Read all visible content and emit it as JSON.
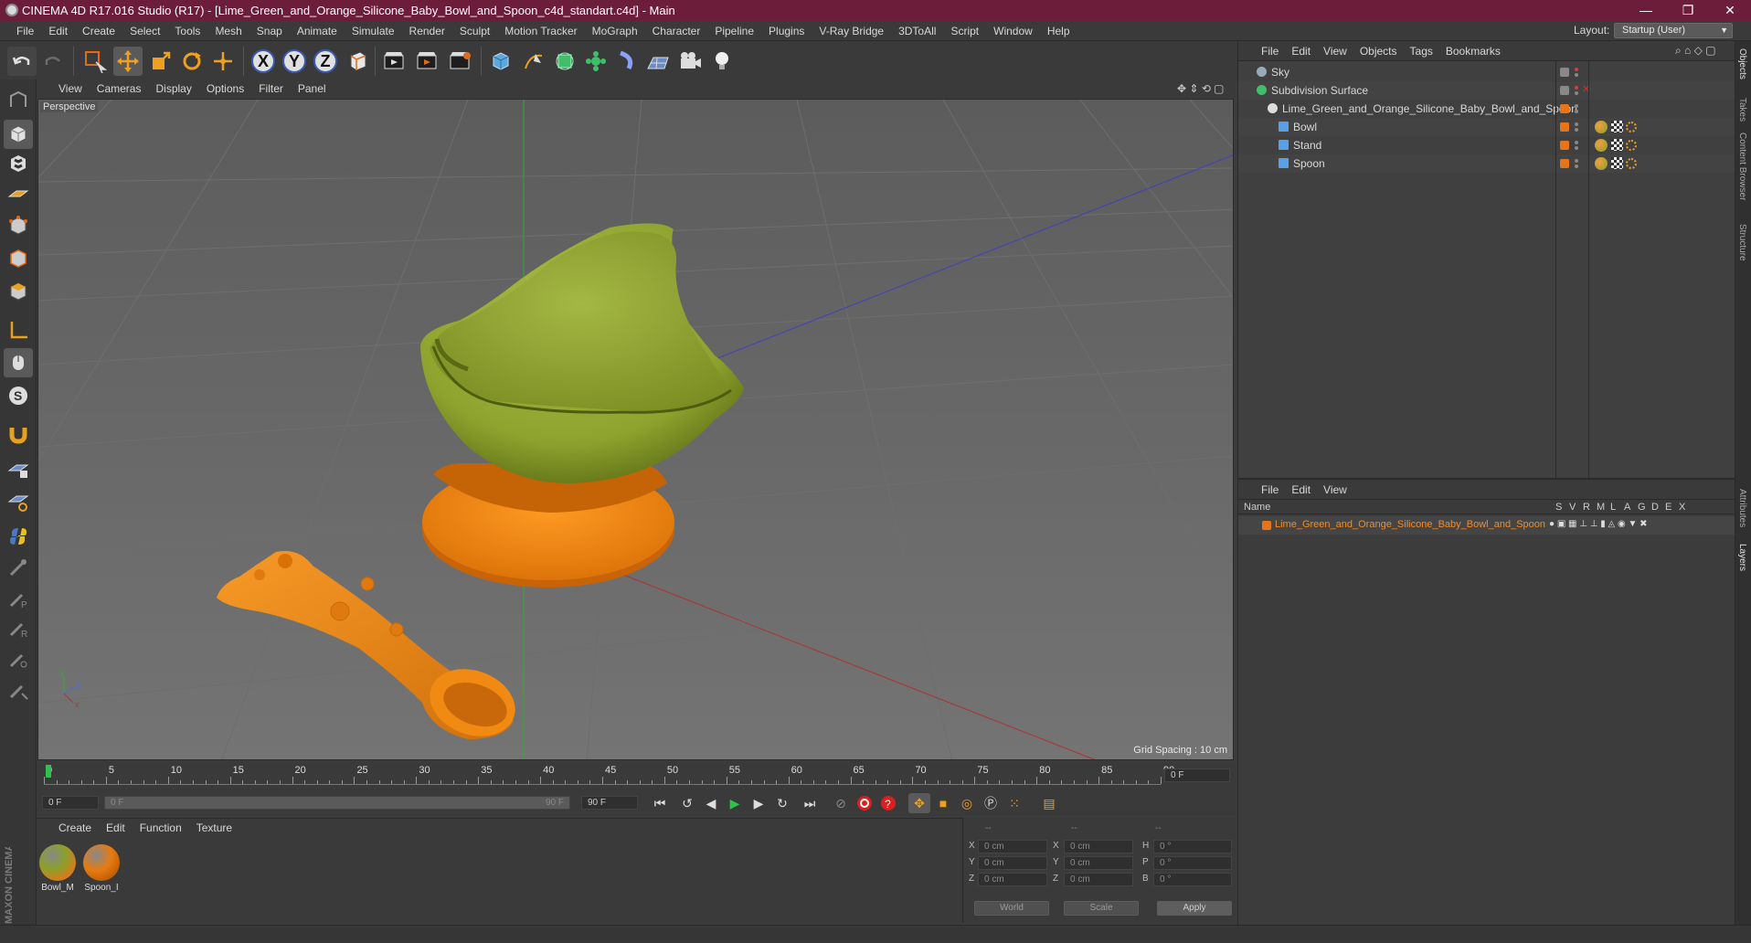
{
  "window": {
    "title": "CINEMA 4D R17.016 Studio (R17) - [Lime_Green_and_Orange_Silicone_Baby_Bowl_and_Spoon_c4d_standart.c4d] - Main",
    "minimize": "—",
    "restore": "❐",
    "close": "✕"
  },
  "menubar": {
    "items": [
      "File",
      "Edit",
      "Create",
      "Select",
      "Tools",
      "Mesh",
      "Snap",
      "Animate",
      "Simulate",
      "Render",
      "Sculpt",
      "Motion Tracker",
      "MoGraph",
      "Character",
      "Pipeline",
      "Plugins",
      "V-Ray Bridge",
      "3DToAll",
      "Script",
      "Window",
      "Help"
    ],
    "layout_label": "Layout:",
    "layout_value": "Startup (User)"
  },
  "toolbar": {
    "undo_icon": "undo-icon",
    "x_label": "X",
    "y_label": "Y",
    "z_label": "Z"
  },
  "viewport": {
    "menu": [
      "View",
      "Cameras",
      "Display",
      "Options",
      "Filter",
      "Panel"
    ],
    "label": "Perspective",
    "grid_spacing": "Grid Spacing : 10 cm",
    "axis_y": "y",
    "axis_z": "z",
    "axis_x": "x"
  },
  "timeline": {
    "ticks": [
      "0",
      "5",
      "10",
      "15",
      "20",
      "25",
      "30",
      "35",
      "40",
      "45",
      "50",
      "55",
      "60",
      "65",
      "70",
      "75",
      "80",
      "85",
      "90"
    ],
    "current_frame": "0 F",
    "start_field": "0 F",
    "range_start": "0 F",
    "range_end": "90 F",
    "end_field": "90 F"
  },
  "material_manager": {
    "menu": [
      "Create",
      "Edit",
      "Function",
      "Texture"
    ],
    "materials": [
      {
        "name": "Bowl_M",
        "color": "#8aa02a"
      },
      {
        "name": "Spoon_I",
        "color": "#e87a10"
      }
    ]
  },
  "coordinates": {
    "headers": [
      "--",
      "--",
      "--"
    ],
    "rows": [
      {
        "a": "X",
        "av": "0 cm",
        "b": "X",
        "bv": "0 cm",
        "c": "H",
        "cv": "0 °"
      },
      {
        "a": "Y",
        "av": "0 cm",
        "b": "Y",
        "bv": "0 cm",
        "c": "P",
        "cv": "0 °"
      },
      {
        "a": "Z",
        "av": "0 cm",
        "b": "Z",
        "bv": "0 cm",
        "c": "B",
        "cv": "0 °"
      }
    ],
    "world": "World",
    "scale": "Scale",
    "apply": "Apply"
  },
  "object_manager": {
    "menu": [
      "File",
      "Edit",
      "View",
      "Objects",
      "Tags",
      "Bookmarks"
    ],
    "objects": [
      {
        "name": "Sky",
        "indent": 0
      },
      {
        "name": "Subdivision Surface",
        "indent": 0
      },
      {
        "name": "Lime_Green_and_Orange_Silicone_Baby_Bowl_and_Spoon",
        "indent": 1
      },
      {
        "name": "Bowl",
        "indent": 2
      },
      {
        "name": "Stand",
        "indent": 2
      },
      {
        "name": "Spoon",
        "indent": 2
      }
    ]
  },
  "layer_manager": {
    "menu": [
      "File",
      "Edit",
      "View"
    ],
    "name_header": "Name",
    "columns": [
      "S",
      "V",
      "R",
      "M",
      "L",
      "A",
      "G",
      "D",
      "E",
      "X"
    ],
    "layer_name": "Lime_Green_and_Orange_Silicone_Baby_Bowl_and_Spoon",
    "layer_color": "#e8741a"
  },
  "right_tabs": [
    "Objects",
    "Takes",
    "Content Browser",
    "Structure",
    "Attributes",
    "Layers"
  ],
  "branding": "MAXON CINEMA 4D",
  "colors": {
    "bowl": "#98ad32",
    "stand": "#f0870f",
    "spoon": "#ee8a12",
    "accent_orange": "#e8741a",
    "title_bar": "#6b1d3a"
  }
}
